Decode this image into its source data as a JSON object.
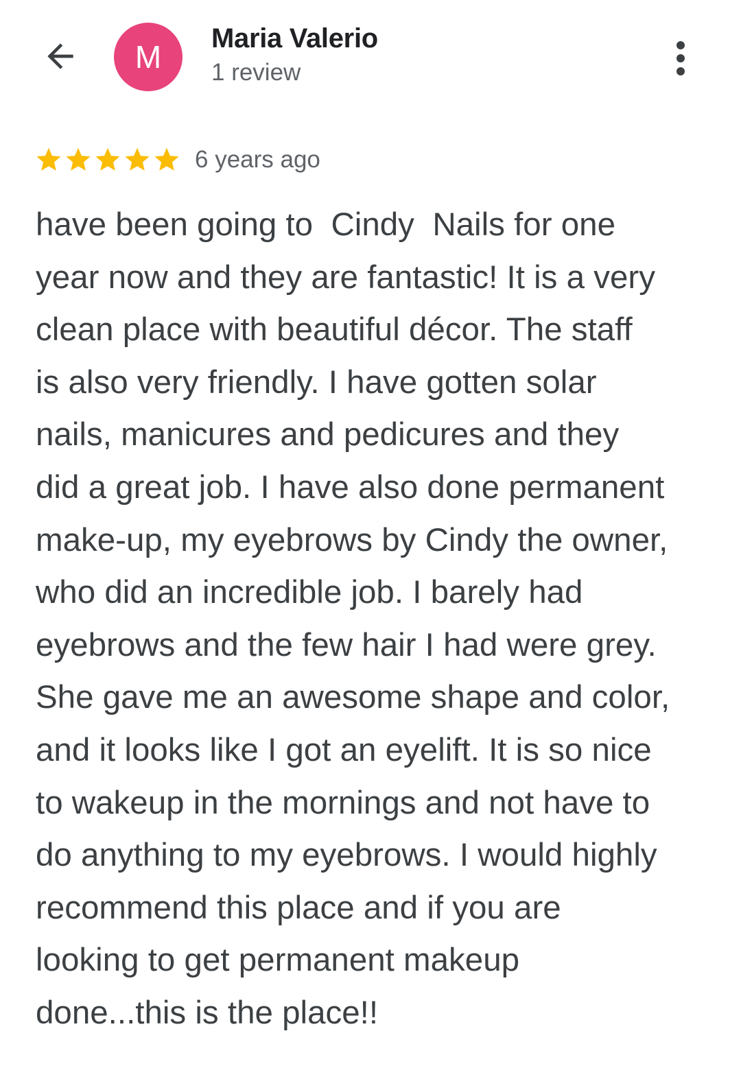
{
  "header": {
    "back_icon": "arrow-back-icon",
    "avatar_letter": "M",
    "avatar_color": "#e8437a",
    "reviewer_name": "Maria Valerio",
    "review_count": "1 review",
    "more_icon": "more-vert-icon"
  },
  "review": {
    "rating": 5,
    "rating_max": 5,
    "star_color": "#fbbc04",
    "time_ago": "6 years ago",
    "text": "have been going to  Cindy  Nails for one\nyear now and they are fantastic! It is a very\nclean place with beautiful décor. The staff\nis also very friendly. I have gotten solar\nnails, manicures and pedicures and they\ndid a great job. I have also done permanent\nmake-up, my eyebrows by Cindy the owner,\nwho did an incredible job. I barely had\neyebrows and the few hair I had were grey.\nShe gave me an awesome shape and color,\nand it looks like I got an eyelift. It is so nice\nto wakeup in the mornings and not have to\ndo anything to my eyebrows. I would highly\nrecommend this place and if you are\nlooking to get permanent makeup\ndone...this is the place!!"
  }
}
